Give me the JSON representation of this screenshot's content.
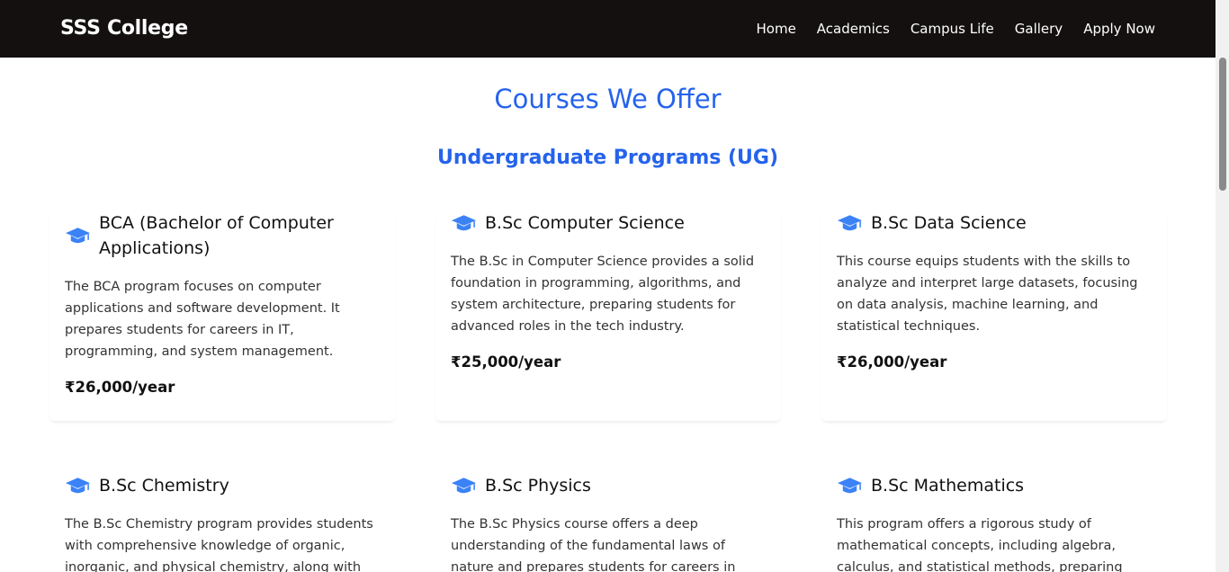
{
  "nav": {
    "brand": "SSS College",
    "links": [
      "Home",
      "Academics",
      "Campus Life",
      "Gallery",
      "Apply Now"
    ]
  },
  "page_title": "Courses We Offer",
  "section_title": "Undergraduate Programs (UG)",
  "icon": "graduation-cap-icon",
  "accent_color": "#2563eb",
  "courses": [
    {
      "name": "BCA (Bachelor of Computer Applications)",
      "description": "The BCA program focuses on computer applications and software development. It prepares students for careers in IT, programming, and system management.",
      "fee": "₹26,000/year"
    },
    {
      "name": "B.Sc Computer Science",
      "description": "The B.Sc in Computer Science provides a solid foundation in programming, algorithms, and system architecture, preparing students for advanced roles in the tech industry.",
      "fee": "₹25,000/year"
    },
    {
      "name": "B.Sc Data Science",
      "description": "This course equips students with the skills to analyze and interpret large datasets, focusing on data analysis, machine learning, and statistical techniques.",
      "fee": "₹26,000/year"
    },
    {
      "name": "B.Sc Chemistry",
      "description": "The B.Sc Chemistry program provides students with comprehensive knowledge of organic, inorganic, and physical chemistry, along with",
      "fee": ""
    },
    {
      "name": "B.Sc Physics",
      "description": "The B.Sc Physics course offers a deep understanding of the fundamental laws of nature and prepares students for careers in research,",
      "fee": ""
    },
    {
      "name": "B.Sc Mathematics",
      "description": "This program offers a rigorous study of mathematical concepts, including algebra, calculus, and statistical methods, preparing",
      "fee": ""
    }
  ]
}
